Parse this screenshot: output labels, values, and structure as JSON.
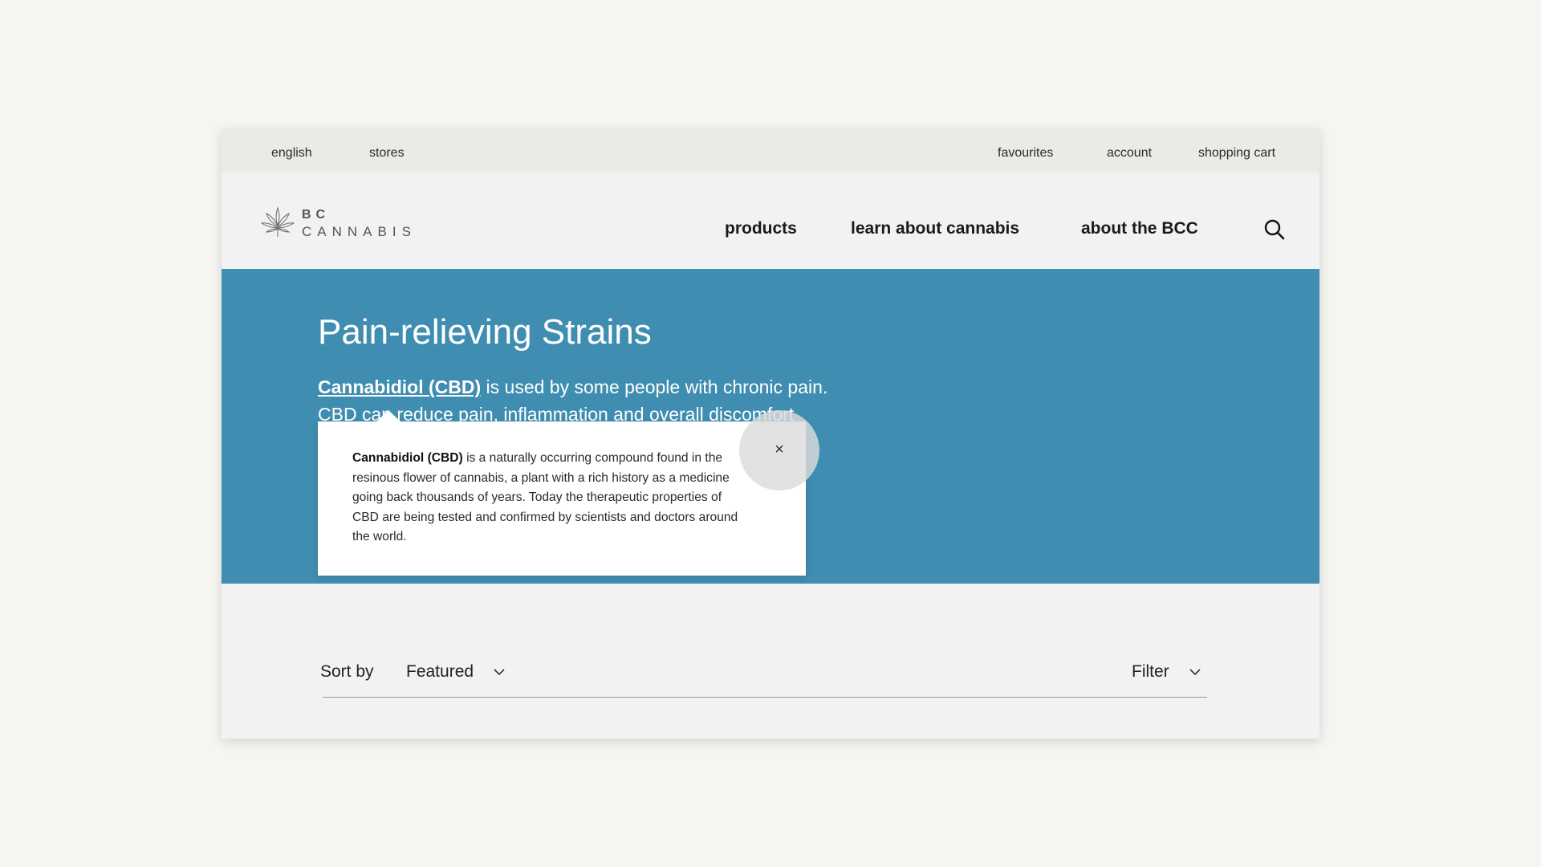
{
  "utility": {
    "language": "english",
    "stores": "stores",
    "favourites": "favourites",
    "account": "account",
    "cart": "shopping cart"
  },
  "logo": {
    "line1": "BC",
    "line2": "CANNABIS"
  },
  "nav": {
    "products": "products",
    "learn": "learn about cannabis",
    "about": "about the BCC"
  },
  "hero": {
    "title": "Pain-relieving Strains",
    "link": "Cannabidiol (CBD)",
    "line1_rest": " is used by some people with chronic pain.",
    "line2": "CBD can reduce pain, inflammation and overall discomfort"
  },
  "popover": {
    "term": "Cannabidiol (CBD)",
    "body": " is a naturally occurring compound found in the resinous flower of cannabis, a plant with a rich history as a medicine going back thousands of years. Today the therapeutic properties of CBD are being tested and confirmed by scientists and doctors around the world.",
    "close": "×"
  },
  "toolbar": {
    "sort_label": "Sort by",
    "sort_value": "Featured",
    "filter_label": "Filter"
  },
  "colors": {
    "hero_bg": "#3f8db0",
    "utility_bg": "#ebeae6",
    "page_bg": "#f2f2f2"
  },
  "icons": [
    "cannabis-leaf-icon",
    "search-icon",
    "close-icon",
    "chevron-down-icon"
  ]
}
